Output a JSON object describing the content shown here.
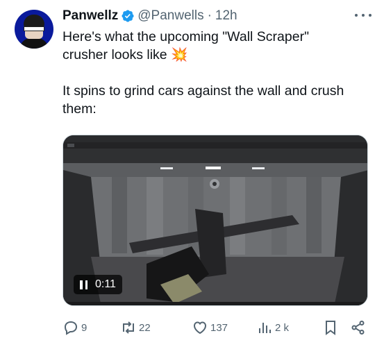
{
  "tweet": {
    "author_name": "Panwellz",
    "handle": "@Panwells",
    "separator": "·",
    "time": "12h",
    "text_line1": "Here's what the upcoming \"Wall Scraper\"",
    "text_line2": "crusher looks like 💥",
    "text_line4": "It spins to grind cars against the wall and crush",
    "text_line5": "them:"
  },
  "media": {
    "type": "video",
    "duration": "0:11",
    "state": "paused-icon-visible"
  },
  "actions": {
    "replies": "9",
    "reposts": "22",
    "likes": "137",
    "views": "2 k"
  },
  "icons": [
    "verified-badge-icon",
    "more-icon",
    "pause-icon",
    "reply-icon",
    "repost-icon",
    "like-icon",
    "views-icon",
    "bookmark-icon",
    "share-icon"
  ],
  "colors": {
    "verified": "#1d9bf0",
    "secondary_text": "#536471",
    "primary_text": "#0f1419"
  }
}
